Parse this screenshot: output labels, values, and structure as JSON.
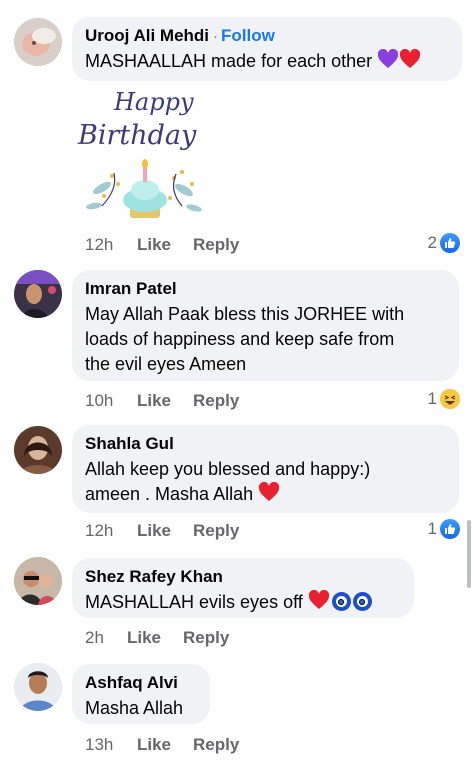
{
  "comments": [
    {
      "name": "Urooj Ali Mehdi",
      "separator": "·",
      "follow": "Follow",
      "text": "MASHAALLAH made for each other",
      "sticker": {
        "line1": "Happy",
        "line2": "Birthday"
      },
      "time": "12h",
      "like": "Like",
      "reply": "Reply",
      "reaction_count": "2",
      "reaction_icon": "like-icon"
    },
    {
      "name": "Imran Patel",
      "text_lines": [
        "May Allah Paak bless this JORHEE with",
        "loads of happiness and keep safe from",
        "the evil eyes Ameen"
      ],
      "time": "10h",
      "like": "Like",
      "reply": "Reply",
      "reaction_count": "1",
      "reaction_icon": "haha-icon"
    },
    {
      "name": "Shahla Gul",
      "text_lines": [
        "Allah keep you blessed and happy:)",
        "ameen . Masha Allah"
      ],
      "time": "12h",
      "like": "Like",
      "reply": "Reply",
      "reaction_count": "1",
      "reaction_icon": "like-icon"
    },
    {
      "name": "Shez Rafey Khan",
      "text": "MASHALLAH evils eyes off",
      "time": "2h",
      "like": "Like",
      "reply": "Reply"
    },
    {
      "name": "Ashfaq Alvi",
      "text": "Masha Allah",
      "time": "13h",
      "like": "Like",
      "reply": "Reply"
    }
  ],
  "colors": {
    "accent": "#1877f2",
    "bubble": "#f0f2f5",
    "meta": "#65676b",
    "heart": "#e8202f"
  }
}
